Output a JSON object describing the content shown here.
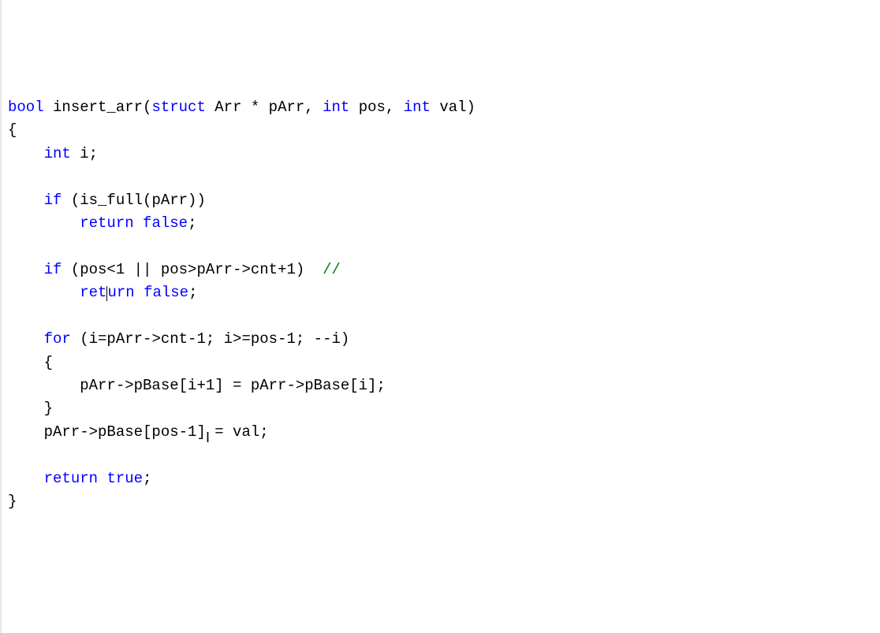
{
  "code": {
    "l1_kw1": "bool",
    "l1_txt1": " insert_arr(",
    "l1_kw2": "struct",
    "l1_txt2": " Arr * pArr, ",
    "l1_kw3": "int",
    "l1_txt3": " pos, ",
    "l1_kw4": "int",
    "l1_txt4": " val)",
    "l2": "{",
    "l3_ind": "    ",
    "l3_kw": "int",
    "l3_txt": " i;",
    "l4": "",
    "l5_ind": "    ",
    "l5_kw": "if",
    "l5_txt": " (is_full(pArr))",
    "l6_ind": "        ",
    "l6_kw": "return",
    "l6_txt": " ",
    "l6_kw2": "false",
    "l6_semi": ";",
    "l7": "",
    "l8_ind": "    ",
    "l8_kw": "if",
    "l8_txt": " (pos<1 || pos>pArr->cnt+1)  ",
    "l8_cmt": "//",
    "l9_ind": "        ",
    "l9_kw_a": "ret",
    "l9_kw_b": "urn",
    "l9_txt": " ",
    "l9_kw2": "false",
    "l9_semi": ";",
    "l10": "",
    "l11_ind": "    ",
    "l11_kw": "for",
    "l11_txt": " (i=pArr->cnt-1; i>=pos-1; --i)",
    "l12": "    {",
    "l13": "        pArr->pBase[i+1] = pArr->pBase[i];",
    "l14": "    }",
    "l15": "    pArr->pBase[pos-1] = val;",
    "l16": "",
    "l17_ind": "    ",
    "l17_kw": "return",
    "l17_txt": " ",
    "l17_kw2": "true",
    "l17_semi": ";",
    "l18": "}"
  },
  "cursor": {
    "ibeam": "I"
  }
}
